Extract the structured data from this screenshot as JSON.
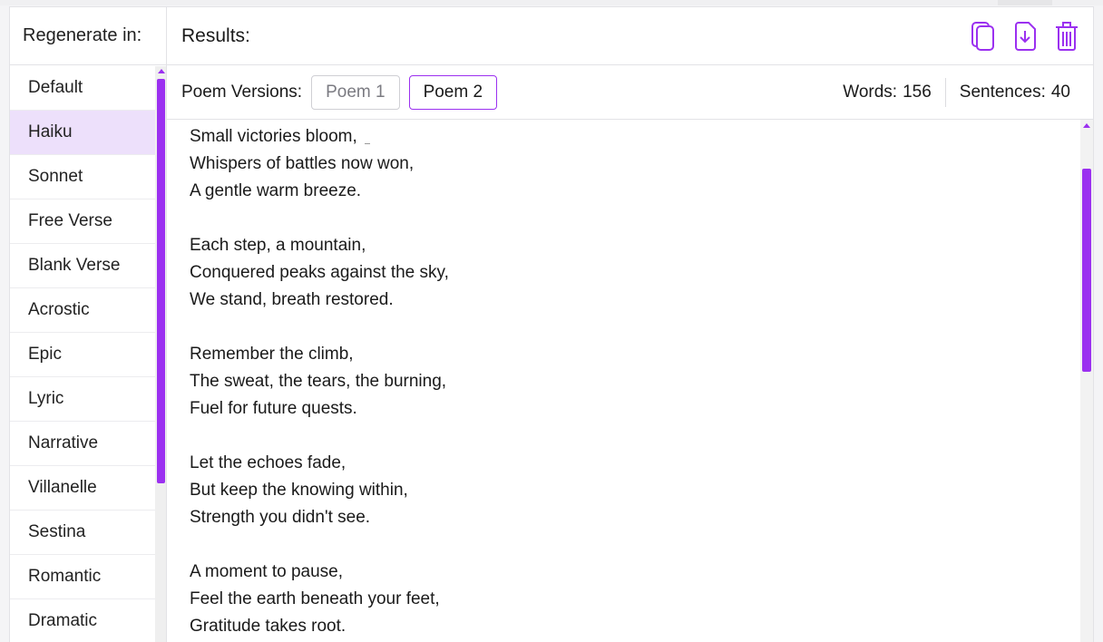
{
  "sidebar": {
    "title": "Regenerate in:",
    "items": [
      {
        "label": "Default"
      },
      {
        "label": "Haiku"
      },
      {
        "label": "Sonnet"
      },
      {
        "label": "Free Verse"
      },
      {
        "label": "Blank Verse"
      },
      {
        "label": "Acrostic"
      },
      {
        "label": "Epic"
      },
      {
        "label": "Lyric"
      },
      {
        "label": "Narrative"
      },
      {
        "label": "Villanelle"
      },
      {
        "label": "Sestina"
      },
      {
        "label": "Romantic"
      },
      {
        "label": "Dramatic"
      }
    ],
    "active_index": 1
  },
  "main": {
    "title": "Results:",
    "actions": {
      "copy_icon": "copy-icon",
      "download_icon": "download-icon",
      "delete_icon": "trash-icon"
    },
    "versions": {
      "label": "Poem Versions:",
      "buttons": [
        {
          "label": "Poem 1"
        },
        {
          "label": "Poem 2"
        }
      ],
      "selected": "Poem 2"
    },
    "stats": {
      "words_label": "Words:",
      "words": "156",
      "sentences_label": "Sentences:",
      "sentences": "40"
    },
    "poem": {
      "stanzas": [
        [
          "Small victories bloom,",
          "Whispers of battles now won,",
          "A gentle warm breeze."
        ],
        [
          "Each step, a mountain,",
          "Conquered peaks against the sky,",
          "We stand, breath restored."
        ],
        [
          "Remember the climb,",
          "The sweat, the tears, the burning,",
          "Fuel for future quests."
        ],
        [
          "Let the echoes fade,",
          "But keep the knowing within,",
          "Strength you didn't see."
        ],
        [
          "A moment to pause,",
          "Feel the earth beneath your feet,",
          "Gratitude takes root."
        ]
      ]
    }
  },
  "colors": {
    "accent": "#9b30f0",
    "active_item_bg": "#ede0fb",
    "border": "#e2e2e6"
  }
}
